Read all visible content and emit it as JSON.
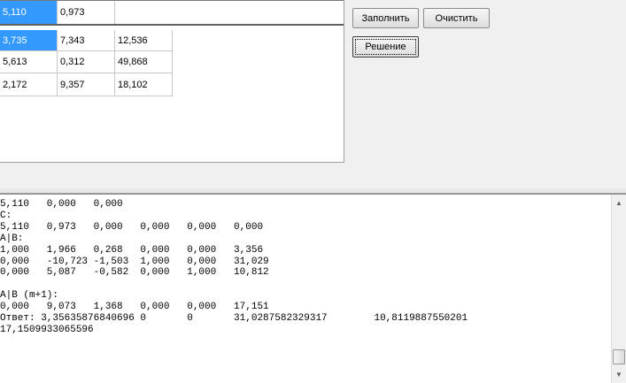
{
  "grid": {
    "top_row": [
      "5,110",
      "0,973"
    ],
    "rows": [
      [
        "3,735",
        "7,343",
        "12,536"
      ],
      [
        "5,613",
        "0,312",
        "49,868"
      ],
      [
        "2,172",
        "9,357",
        "18,102"
      ]
    ]
  },
  "buttons": {
    "fill": "Заполнить",
    "clear": "Очистить",
    "solve": "Решение"
  },
  "output_lines": [
    "5,110   0,000   0,000",
    "C:",
    "5,110   0,973   0,000   0,000   0,000   0,000",
    "A|B:",
    "1,000   1,966   0,268   0,000   0,000   3,356",
    "0,000   -10,723 -1,503  1,000   0,000   31,029",
    "0,000   5,087   -0,582  0,000   1,000   10,812",
    "",
    "A|B (m+1):",
    "0,000   9,073   1,368   0,000   0,000   17,151",
    "Ответ: 3,35635876840696 0       0       31,0287582329317        10,8119887550201",
    "17,1509933065596"
  ],
  "icons": {
    "scroll_up": "▲",
    "scroll_down": "▼"
  }
}
